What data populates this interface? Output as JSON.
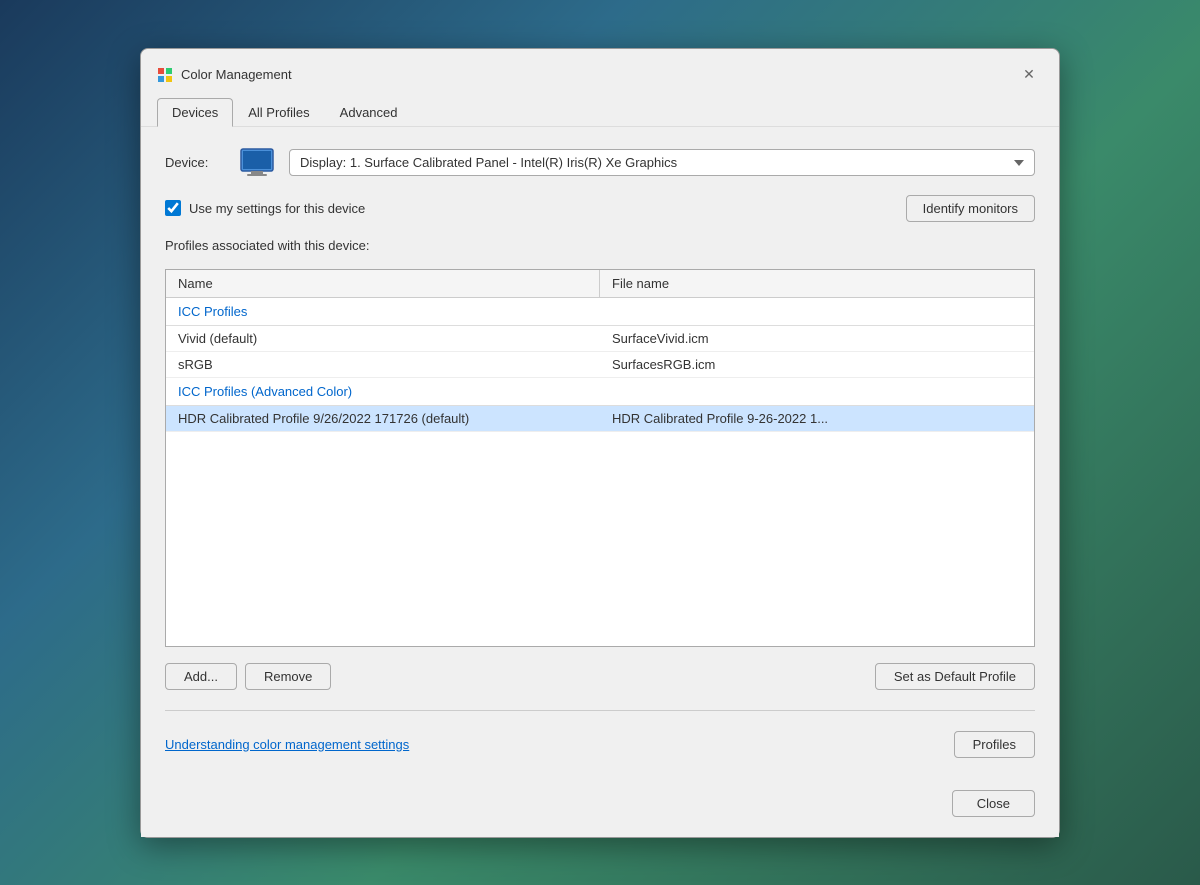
{
  "window": {
    "title": "Color Management",
    "icon": "🎨"
  },
  "tabs": [
    {
      "id": "devices",
      "label": "Devices",
      "active": true
    },
    {
      "id": "all-profiles",
      "label": "All Profiles",
      "active": false
    },
    {
      "id": "advanced",
      "label": "Advanced",
      "active": false
    }
  ],
  "device_section": {
    "label": "Device:",
    "dropdown_value": "Display: 1. Surface Calibrated Panel - Intel(R) Iris(R) Xe Graphics",
    "checkbox_label": "Use my settings for this device",
    "checkbox_checked": true,
    "identify_btn": "Identify monitors"
  },
  "profiles_section": {
    "label": "Profiles associated with this device:",
    "columns": [
      "Name",
      "File name"
    ],
    "groups": [
      {
        "header": "ICC Profiles",
        "rows": [
          {
            "name": "Vivid (default)",
            "filename": "SurfaceVivid.icm",
            "selected": false
          },
          {
            "name": "sRGB",
            "filename": "SurfacesRGB.icm",
            "selected": false
          }
        ]
      },
      {
        "header": "ICC Profiles (Advanced Color)",
        "rows": [
          {
            "name": "HDR Calibrated Profile 9/26/2022 171726 (default)",
            "filename": "HDR Calibrated Profile 9-26-2022 1...",
            "selected": true
          }
        ]
      }
    ]
  },
  "action_buttons": {
    "add": "Add...",
    "remove": "Remove",
    "set_default": "Set as Default Profile"
  },
  "footer": {
    "link_text": "Understanding color management settings",
    "profiles_btn": "Profiles",
    "close_btn": "Close"
  }
}
